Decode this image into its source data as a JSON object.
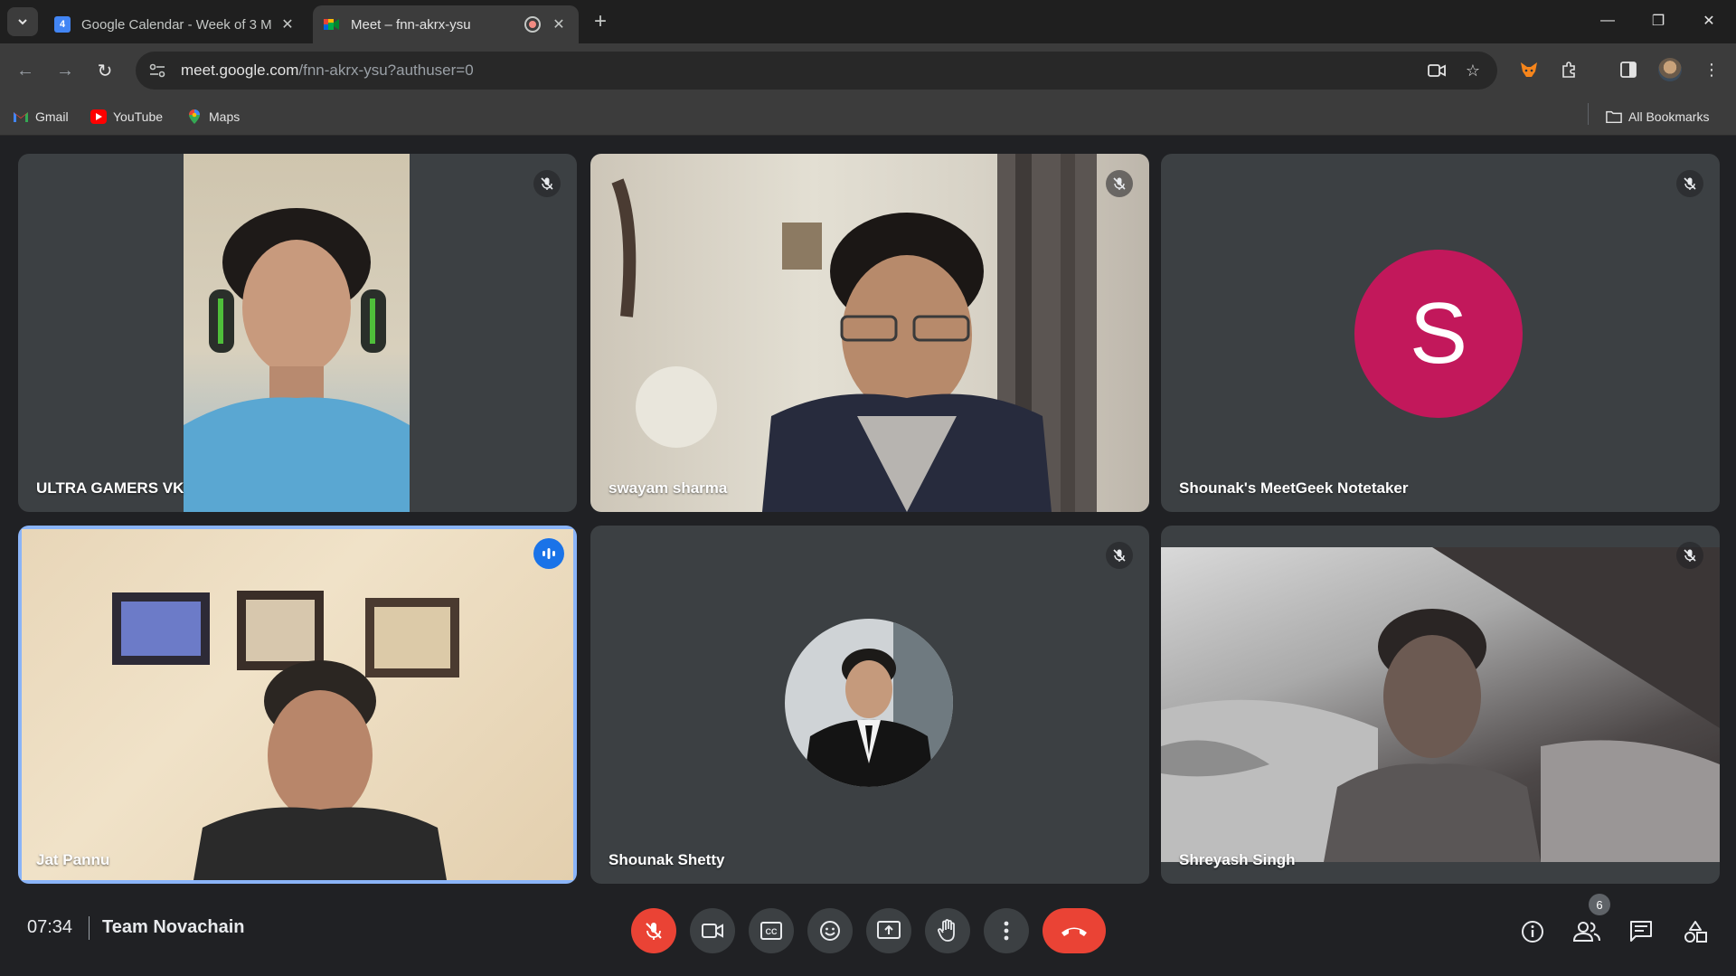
{
  "browser": {
    "tabs": [
      {
        "title": "Google Calendar - Week of 3 M",
        "favicon_text": "4",
        "active": false
      },
      {
        "title": "Meet – fnn-akrx-ysu",
        "active": true
      }
    ],
    "url_host": "meet.google.com",
    "url_path": "/fnn-akrx-ysu?authuser=0",
    "bookmarks": [
      {
        "label": "Gmail",
        "icon": "gmail-icon"
      },
      {
        "label": "YouTube",
        "icon": "youtube-icon"
      },
      {
        "label": "Maps",
        "icon": "maps-icon"
      }
    ],
    "all_bookmarks": "All Bookmarks"
  },
  "meet": {
    "participants": [
      {
        "name": "ULTRA GAMERS VK",
        "state": "video",
        "muted": true
      },
      {
        "name": "swayam sharma",
        "state": "video",
        "muted": true
      },
      {
        "name": "Shounak's MeetGeek Notetaker",
        "state": "avatar-letter",
        "avatar_letter": "S",
        "avatar_color": "#c2185b",
        "muted": true
      },
      {
        "name": "Jat Pannu",
        "state": "video",
        "speaking": true,
        "muted": false
      },
      {
        "name": "Shounak Shetty",
        "state": "avatar-photo",
        "muted": true
      },
      {
        "name": "Shreyash Singh",
        "state": "video",
        "muted": true
      }
    ],
    "bottom_bar": {
      "time": "07:34",
      "meeting_title": "Team Novachain",
      "participant_count": "6",
      "controls": [
        "mic-off-icon",
        "camera-icon",
        "captions-icon",
        "emoji-icon",
        "present-icon",
        "raise-hand-icon",
        "more-vert-icon",
        "end-call-icon"
      ],
      "side_controls": [
        "info-icon",
        "people-icon",
        "chat-icon",
        "activities-icon"
      ]
    }
  },
  "colors": {
    "accent": "#8ab4f8",
    "end_call": "#ea4335",
    "speaking_badge": "#1a73e8",
    "tile_bg": "#3c4043"
  }
}
